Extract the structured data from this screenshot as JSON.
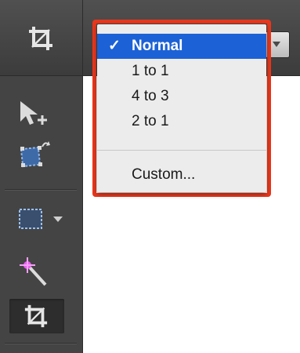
{
  "options_bar": {
    "active_tool_icon": "crop-icon"
  },
  "toolbar": {
    "tools": [
      {
        "icon": "move-icon"
      },
      {
        "icon": "transform-icon"
      },
      {
        "icon": "marquee-icon"
      },
      {
        "icon": "magic-wand-icon"
      },
      {
        "icon": "crop-icon",
        "active": true
      }
    ]
  },
  "aspect_menu": {
    "check_mark": "✓",
    "items": [
      "Normal",
      "1 to 1",
      "4 to 3",
      "2 to 1"
    ],
    "selected": "Normal",
    "custom_label": "Custom..."
  },
  "colors": {
    "highlight_border": "#e8371c",
    "selection": "#1c62d6",
    "toolbar_bg": "#444444"
  }
}
